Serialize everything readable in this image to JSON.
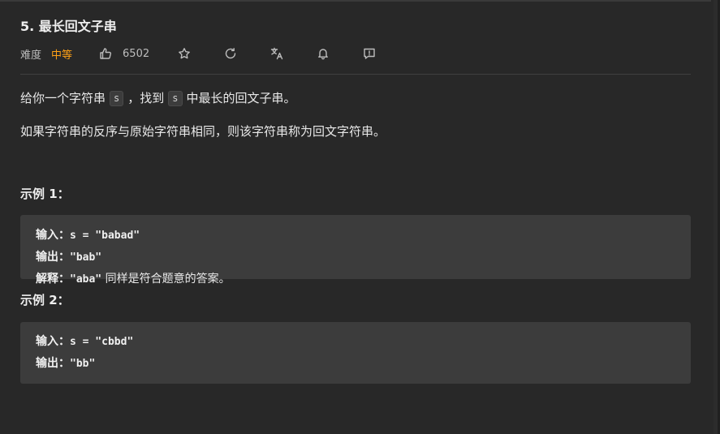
{
  "problem": {
    "title": "5. 最长回文子串",
    "difficulty_label": "难度",
    "difficulty_value": "中等",
    "likes": "6502",
    "accent_color": "#ffa116",
    "icons": [
      "thumbs-up-icon",
      "star-icon",
      "refresh-icon",
      "translate-icon",
      "bell-icon",
      "feedback-icon"
    ]
  },
  "description": {
    "p1": {
      "a": "给你一个字符串",
      "code1": "s",
      "b": "，找到",
      "code2": "s",
      "c": "中最长的回文子串。"
    },
    "p2": "如果字符串的反序与原始字符串相同，则该字符串称为回文字符串。"
  },
  "examples": [
    {
      "title": "示例 1：",
      "lines": [
        {
          "key": "输入：",
          "value": "s = \"babad\"",
          "tail": ""
        },
        {
          "key": "输出：",
          "value": "\"bab\"",
          "tail": ""
        },
        {
          "key": "解释：",
          "value": "\"aba\"",
          "tail": " 同样是符合题意的答案。"
        }
      ]
    },
    {
      "title": "示例 2：",
      "lines": [
        {
          "key": "输入：",
          "value": "s = \"cbbd\"",
          "tail": ""
        },
        {
          "key": "输出：",
          "value": "\"bb\"",
          "tail": ""
        }
      ]
    }
  ]
}
